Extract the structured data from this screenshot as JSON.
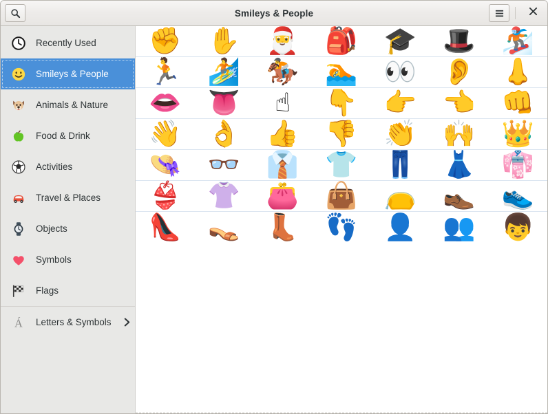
{
  "window": {
    "title": "Smileys & People",
    "search_icon": "search-icon",
    "menu_icon": "hamburger-menu-icon",
    "close_icon": "close-icon",
    "accent_color": "#4a90d9",
    "sidebar_bg": "#e8e8e6",
    "separator_color": "#dbe5f0"
  },
  "sidebar": {
    "items": [
      {
        "label": "Recently Used",
        "icon": "clock-icon",
        "selected": false
      },
      {
        "label": "Smileys & People",
        "icon": "smiley-icon",
        "selected": true
      },
      {
        "label": "Animals & Nature",
        "icon": "dog-face-icon",
        "selected": false
      },
      {
        "label": "Food & Drink",
        "icon": "green-apple-icon",
        "selected": false
      },
      {
        "label": "Activities",
        "icon": "soccer-ball-icon",
        "selected": false
      },
      {
        "label": "Travel & Places",
        "icon": "red-car-icon",
        "selected": false
      },
      {
        "label": "Objects",
        "icon": "watch-icon",
        "selected": false
      },
      {
        "label": "Symbols",
        "icon": "heart-icon",
        "selected": false
      },
      {
        "label": "Flags",
        "icon": "chequered-flag-icon",
        "selected": false
      }
    ],
    "footer": {
      "label": "Letters & Symbols",
      "icon": "a-acute-letter-icon",
      "chevron": "chevron-right-icon"
    }
  },
  "grid": {
    "columns": 7,
    "rows": [
      [
        {
          "glyph": "✊",
          "name": "raised-fist"
        },
        {
          "glyph": "✋",
          "name": "raised-hand"
        },
        {
          "glyph": "🎅",
          "name": "santa-claus"
        },
        {
          "glyph": "🎒",
          "name": "school-backpack"
        },
        {
          "glyph": "🎓",
          "name": "graduation-cap"
        },
        {
          "glyph": "🎩",
          "name": "top-hat"
        },
        {
          "glyph": "🏂",
          "name": "snowboarder"
        }
      ],
      [
        {
          "glyph": "🏃",
          "name": "runner"
        },
        {
          "glyph": "🏄",
          "name": "surfer"
        },
        {
          "glyph": "🏇",
          "name": "horse-racing"
        },
        {
          "glyph": "🏊",
          "name": "swimmer"
        },
        {
          "glyph": "👀",
          "name": "eyes"
        },
        {
          "glyph": "👂",
          "name": "ear"
        },
        {
          "glyph": "👃",
          "name": "nose"
        }
      ],
      [
        {
          "glyph": "👄",
          "name": "mouth"
        },
        {
          "glyph": "👅",
          "name": "tongue"
        },
        {
          "glyph": "☝",
          "name": "index-pointing-up"
        },
        {
          "glyph": "👇",
          "name": "index-pointing-down"
        },
        {
          "glyph": "👉",
          "name": "index-pointing-right"
        },
        {
          "glyph": "👈",
          "name": "index-pointing-left"
        },
        {
          "glyph": "👊",
          "name": "oncoming-fist"
        }
      ],
      [
        {
          "glyph": "👋",
          "name": "waving-hand"
        },
        {
          "glyph": "👌",
          "name": "ok-hand"
        },
        {
          "glyph": "👍",
          "name": "thumbs-up"
        },
        {
          "glyph": "👎",
          "name": "thumbs-down"
        },
        {
          "glyph": "👏",
          "name": "clapping-hands"
        },
        {
          "glyph": "🙌",
          "name": "raising-hands"
        },
        {
          "glyph": "👑",
          "name": "crown"
        }
      ],
      [
        {
          "glyph": "👒",
          "name": "womans-hat"
        },
        {
          "glyph": "👓",
          "name": "glasses"
        },
        {
          "glyph": "👔",
          "name": "necktie"
        },
        {
          "glyph": "👕",
          "name": "t-shirt"
        },
        {
          "glyph": "👖",
          "name": "jeans"
        },
        {
          "glyph": "👗",
          "name": "dress"
        },
        {
          "glyph": "👘",
          "name": "kimono"
        }
      ],
      [
        {
          "glyph": "👙",
          "name": "bikini"
        },
        {
          "glyph": "👚",
          "name": "womans-clothes"
        },
        {
          "glyph": "👛",
          "name": "purse"
        },
        {
          "glyph": "👜",
          "name": "handbag"
        },
        {
          "glyph": "👝",
          "name": "clutch-bag"
        },
        {
          "glyph": "👞",
          "name": "mans-shoe"
        },
        {
          "glyph": "👟",
          "name": "running-shoe"
        }
      ],
      [
        {
          "glyph": "👠",
          "name": "high-heeled-shoe"
        },
        {
          "glyph": "👡",
          "name": "womans-sandal"
        },
        {
          "glyph": "👢",
          "name": "womans-boot"
        },
        {
          "glyph": "👣",
          "name": "footprints"
        },
        {
          "glyph": "👤",
          "name": "bust-in-silhouette"
        },
        {
          "glyph": "👥",
          "name": "busts-in-silhouette"
        },
        {
          "glyph": "👦",
          "name": "boy"
        }
      ]
    ]
  }
}
